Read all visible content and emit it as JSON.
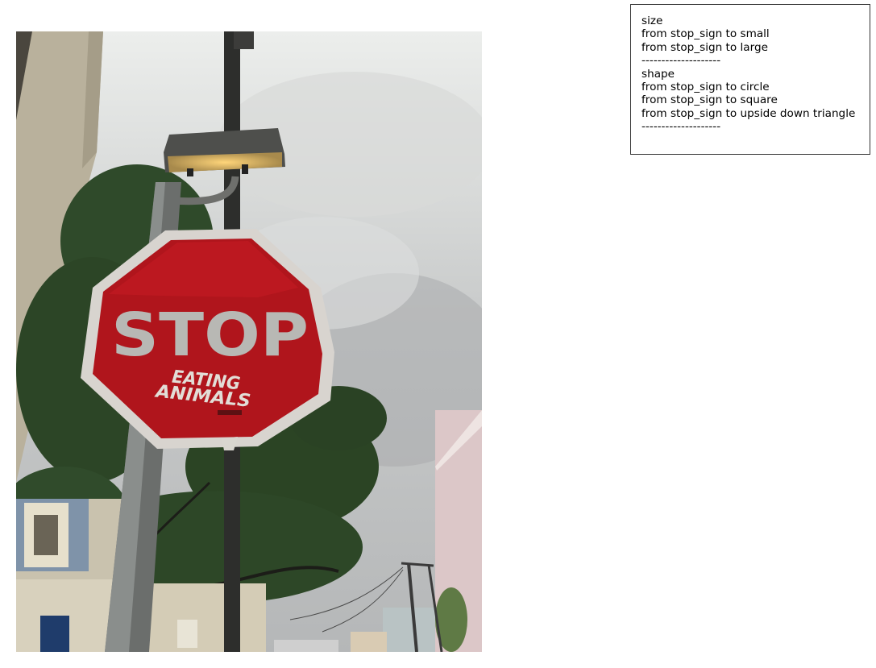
{
  "photo": {
    "sign_text": "STOP",
    "sticker_line1": "EATING",
    "sticker_line2": "ANIMALS"
  },
  "legend": {
    "lines": [
      "size",
      "from stop_sign to small",
      "from stop_sign to large",
      "--------------------",
      "shape",
      "from stop_sign to circle",
      "from stop_sign to square",
      "from stop_sign to upside down triangle",
      "--------------------"
    ]
  }
}
